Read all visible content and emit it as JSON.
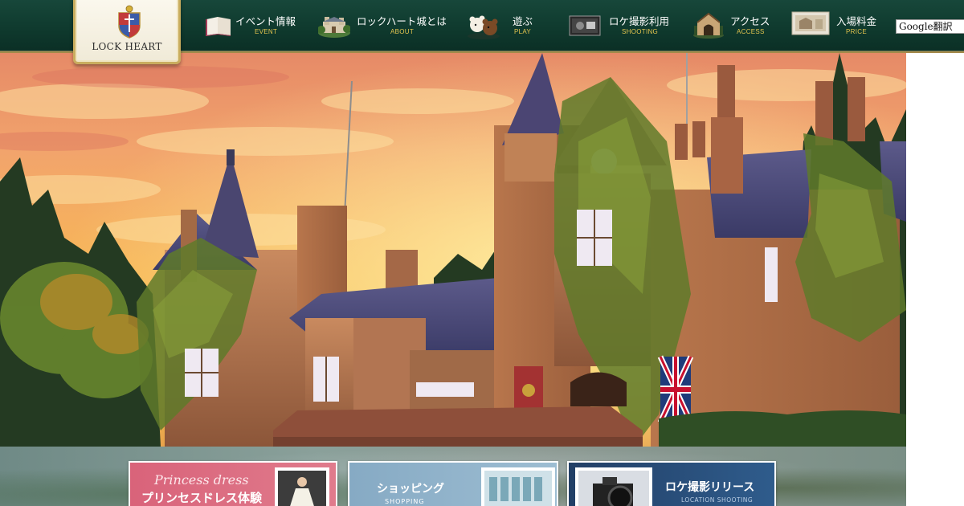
{
  "header": {
    "logo_text": "LOCK HEART",
    "translate_label": "Google翻訳",
    "nav": [
      {
        "label": "イベント情報",
        "sub": "EVENT",
        "icon": "book-icon"
      },
      {
        "label": "ロックハート城とは",
        "sub": "ABOUT",
        "icon": "castle-icon"
      },
      {
        "label": "遊ぶ",
        "sub": "PLAY",
        "icon": "teddy-bear-icon"
      },
      {
        "label": "ロケ撮影利用",
        "sub": "SHOOTING",
        "icon": "film-camera-icon"
      },
      {
        "label": "アクセス",
        "sub": "ACCESS",
        "icon": "gate-icon"
      },
      {
        "label": "入場料金",
        "sub": "PRICE",
        "icon": "ticket-icon"
      }
    ]
  },
  "hero": {
    "description": "castle-at-sunset-image"
  },
  "banners": [
    {
      "title_en": "Princess dress",
      "title": "プリンセスドレス体験",
      "sub": "",
      "color": "#d9637a"
    },
    {
      "title_en": "",
      "title": "ショッピング",
      "sub": "SHOPPING",
      "color": "#8fb2c9"
    },
    {
      "title_en": "",
      "title": "ロケ撮影リリース",
      "sub": "LOCATION SHOOTING",
      "color": "#2f5c8c"
    }
  ],
  "colors": {
    "header_bg": "#0f3a2e",
    "nav_sub": "#e3c44e",
    "gold_border": "#c9ad5e"
  }
}
